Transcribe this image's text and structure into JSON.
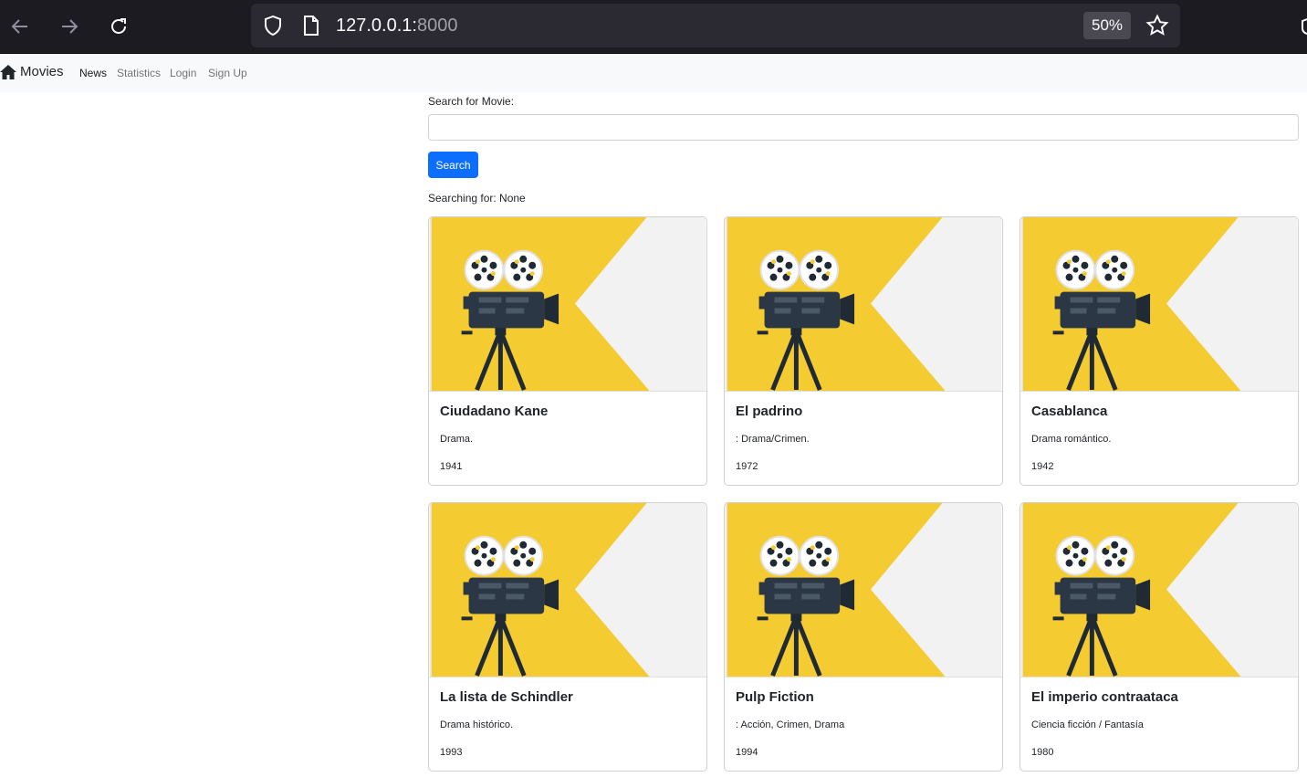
{
  "browser": {
    "url_host": "127.0.0.1:",
    "url_port": "8000",
    "zoom": "50%",
    "icons": [
      "back-arrow-icon",
      "forward-arrow-icon",
      "reload-icon",
      "shield-icon",
      "page-icon",
      "star-icon"
    ]
  },
  "navbar": {
    "brand": "Movies",
    "brand_icon": "house-icon",
    "links": [
      {
        "label": "News",
        "active": true
      },
      {
        "label": "Statistics",
        "active": false
      },
      {
        "label": "Login",
        "active": false
      },
      {
        "label": "Sign Up",
        "active": false
      }
    ]
  },
  "search": {
    "label": "Search for Movie:",
    "value": "",
    "button_label": "Search",
    "status": "Searching for: None"
  },
  "colors": {
    "accent": "#0d6efd",
    "poster_yellow": "#f5cb32",
    "poster_light": "#f2f2f2"
  },
  "movies": [
    {
      "title": "Ciudadano Kane",
      "genre": "Drama.",
      "year": "1941"
    },
    {
      "title": "El padrino",
      "genre": ": Drama/Crimen.",
      "year": "1972"
    },
    {
      "title": "Casablanca",
      "genre": "Drama romántico.",
      "year": "1942"
    },
    {
      "title": "La lista de Schindler",
      "genre": "Drama histórico.",
      "year": "1993"
    },
    {
      "title": "Pulp Fiction",
      "genre": ": Acción, Crimen, Drama",
      "year": "1994"
    },
    {
      "title": "El imperio contraataca",
      "genre": "Ciencia ficción / Fantasía",
      "year": "1980"
    }
  ]
}
